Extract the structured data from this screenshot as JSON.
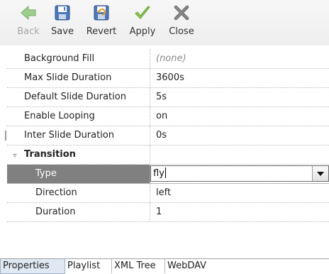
{
  "toolbar": {
    "back_label": "Back",
    "save_label": "Save",
    "revert_label": "Revert",
    "apply_label": "Apply",
    "close_label": "Close",
    "icons": {
      "back": "arrow-left-icon",
      "save": "floppy-disk-icon",
      "revert": "revert-document-icon",
      "apply": "checkmark-icon",
      "close": "x-close-icon"
    }
  },
  "properties": {
    "rows": [
      {
        "name": "Background Fill",
        "value": "(none)"
      },
      {
        "name": "Max Slide Duration",
        "value": "3600s"
      },
      {
        "name": "Default Slide Duration",
        "value": "5s"
      },
      {
        "name": "Enable Looping",
        "value": "on"
      },
      {
        "name": "Inter Slide Duration",
        "value": "0s"
      }
    ],
    "group": {
      "expander": "▿",
      "name": "Transition",
      "children": {
        "type": {
          "name": "Type",
          "value": "fly"
        },
        "direction": {
          "name": "Direction",
          "value": "left"
        },
        "duration": {
          "name": "Duration",
          "value": "1"
        }
      }
    }
  },
  "tabs": {
    "properties": "Properties",
    "playlist": "Playlist",
    "xml_tree": "XML Tree",
    "webdav": "WebDAV",
    "active": "Properties"
  },
  "colors": {
    "selected_row": "#808080",
    "active_tab": "#dfe8f3",
    "apply_green": "#7fbf3f",
    "back_green": "#6faf5f"
  }
}
